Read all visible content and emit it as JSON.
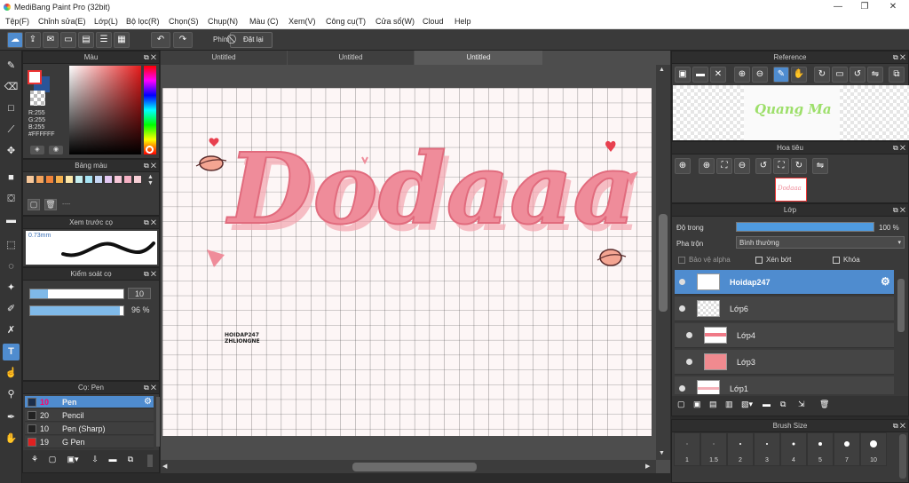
{
  "window": {
    "title": "MediBang Paint Pro (32bit)"
  },
  "menu": [
    "Tệp(F)",
    "Chỉnh sửa(E)",
    "Lớp(L)",
    "Bộ lọc(R)",
    "Chọn(S)",
    "Chụp(N)",
    "Màu (C)",
    "Xem(V)",
    "Công cụ(T)",
    "Cửa sổ(W)",
    "Cloud",
    "Help"
  ],
  "toolbar": {
    "key_label": "Phím",
    "reset_label": "Đặt lại"
  },
  "color_panel": {
    "title": "Màu",
    "r": "R:255",
    "g": "G:255",
    "b": "B:255",
    "hex": "#FFFFFF",
    "fg": "#ffffff",
    "bg": "#2a5599"
  },
  "palette_panel": {
    "title": "Bảng màu",
    "swatches": [
      "#f7c89b",
      "#f4a35b",
      "#f0843a",
      "#f5b04d",
      "#fde7a8",
      "#c4eef0",
      "#a7e4f4",
      "#c7d7f5",
      "#e3c8f2",
      "#f7c7d8",
      "#f5b1c4",
      "#f7cfd6"
    ],
    "footer_text": "----"
  },
  "brush_preview": {
    "title": "Xem trước cọ",
    "size": "0.73mm"
  },
  "brush_control": {
    "title": "Kiểm soát cọ",
    "size_value": "10",
    "opacity_value": "96 %",
    "opacity": 0.96
  },
  "brush_list": {
    "title": "Cọ: Pen",
    "items": [
      {
        "size": "10",
        "name": "Pen",
        "color": "#1c2e4a"
      },
      {
        "size": "20",
        "name": "Pencil",
        "color": "#222222"
      },
      {
        "size": "10",
        "name": "Pen (Sharp)",
        "color": "#222222"
      },
      {
        "size": "19",
        "name": "G Pen",
        "color": "#e02020"
      }
    ]
  },
  "tabs": [
    "Untitled",
    "Untitled",
    "Untitled"
  ],
  "artwork": {
    "main_text": "Dodaaa",
    "signature_line1": "HOIDAP247",
    "signature_line2": "ZHLIONGNE"
  },
  "reference": {
    "title": "Reference",
    "preview_text": "Quang Ma"
  },
  "navigator": {
    "title": "Hoa tiêu",
    "thumb_text": "Dodaaa"
  },
  "layers": {
    "title": "Lớp",
    "opacity_label": "Độ trong",
    "opacity_value": "100 %",
    "opacity": 1.0,
    "blend_label": "Pha trộn",
    "blend_value": "Bình thường",
    "protect_alpha": "Bảo vệ alpha",
    "clip": "Xén bớt",
    "lock": "Khóa",
    "items": [
      {
        "name": "Hoidap247",
        "selected": true
      },
      {
        "name": "Lớp6",
        "selected": false
      },
      {
        "name": "Lớp4",
        "selected": false
      },
      {
        "name": "Lớp3",
        "selected": false
      },
      {
        "name": "Lớp1",
        "selected": false
      }
    ]
  },
  "brush_size": {
    "title": "Brush Size",
    "sizes": [
      "1",
      "1.5",
      "2",
      "3",
      "4",
      "5",
      "7",
      "10"
    ]
  }
}
